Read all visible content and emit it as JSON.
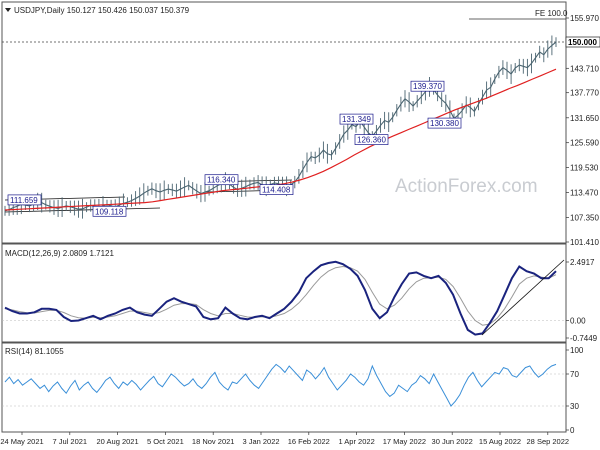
{
  "header": {
    "symbol_label": "USDJPY,Daily",
    "ohlc": "150.127 150.426 150.037 150.379",
    "marker_icon": "triangle-down-icon"
  },
  "watermark": "ActionForex.com",
  "fe_label": "FE 100.0",
  "current_price_label": "150.000",
  "price_levels": [
    {
      "label": "111.659",
      "value": 111.66
    },
    {
      "label": "109.118",
      "value": 109.12
    },
    {
      "label": "116.340",
      "value": 116.34
    },
    {
      "label": "114.408",
      "value": 114.41
    },
    {
      "label": "131.349",
      "value": 131.35
    },
    {
      "label": "126.360",
      "value": 126.36
    },
    {
      "label": "139.370",
      "value": 139.37
    },
    {
      "label": "130.380",
      "value": 130.38
    }
  ],
  "macd_label": "MACD(12,26,9) 2.0809 1.7121",
  "rsi_label": "RSI(14) 81.1055",
  "chart_data": [
    {
      "type": "line",
      "panel": "price",
      "y_ticks": [
        "155.970",
        "150.000",
        "143.710",
        "137.770",
        "131.650",
        "125.590",
        "119.530",
        "113.470",
        "107.350",
        "101.410"
      ],
      "ylim": [
        101.41,
        155.97
      ],
      "x_ticks": [
        "24 May 2021",
        "7 Jul 2021",
        "20 Aug 2021",
        "5 Oct 2021",
        "18 Nov 2021",
        "3 Jan 2022",
        "16 Feb 2022",
        "1 Apr 2022",
        "17 May 2022",
        "30 Jun 2022",
        "15 Aug 2022",
        "28 Sep 2022"
      ],
      "series": [
        {
          "name": "USDJPY",
          "color": "#4a6470",
          "values": [
            109.0,
            109.3,
            109.8,
            110.1,
            110.6,
            110.4,
            110.2,
            110.7,
            111.3,
            111.0,
            110.5,
            110.1,
            109.8,
            109.6,
            109.9,
            110.2,
            110.0,
            109.7,
            109.4,
            109.5,
            109.9,
            110.3,
            110.0,
            109.8,
            110.2,
            110.5,
            110.2,
            110.0,
            110.4,
            110.8,
            111.1,
            111.5,
            112.0,
            112.6,
            113.3,
            113.9,
            114.4,
            113.9,
            113.6,
            114.0,
            114.3,
            114.1,
            113.8,
            114.3,
            114.8,
            115.2,
            114.5,
            113.8,
            113.2,
            113.6,
            113.9,
            114.5,
            115.1,
            115.6,
            116.0,
            115.5,
            114.7,
            114.2,
            114.5,
            114.9,
            115.4,
            115.7,
            115.9,
            115.3,
            115.0,
            115.4,
            115.8,
            115.6,
            115.2,
            115.0,
            115.4,
            116.0,
            117.4,
            119.1,
            120.8,
            122.2,
            121.9,
            122.6,
            123.8,
            122.9,
            122.6,
            124.2,
            125.9,
            127.7,
            128.7,
            130.0,
            129.5,
            130.8,
            129.4,
            128.0,
            127.2,
            128.4,
            129.8,
            131.0,
            130.6,
            131.8,
            133.5,
            135.0,
            136.3,
            135.5,
            134.5,
            135.7,
            136.8,
            138.0,
            139.2,
            138.5,
            137.2,
            136.1,
            135.2,
            133.5,
            131.5,
            132.3,
            133.4,
            134.8,
            134.2,
            133.2,
            135.0,
            136.7,
            138.4,
            139.1,
            141.1,
            142.8,
            143.9,
            143.2,
            142.3,
            143.8,
            144.5,
            144.2,
            143.9,
            144.9,
            146.3,
            147.7,
            147.0,
            148.4,
            149.3,
            150.1
          ]
        },
        {
          "name": "MA",
          "color": "#e02020",
          "values": [
            109.2,
            109.3,
            109.4,
            109.5,
            109.6,
            109.7,
            109.8,
            109.9,
            110.0,
            110.1,
            110.2,
            110.3,
            110.4,
            110.5,
            110.6,
            110.7,
            110.8,
            110.9,
            111.0,
            111.2,
            111.5,
            111.8,
            112.1,
            112.4,
            112.7,
            113.0,
            113.3,
            113.6,
            113.9,
            114.1,
            114.3,
            114.5,
            114.7,
            114.9,
            115.1,
            115.3,
            115.6,
            116.0,
            116.5,
            117.1,
            117.8,
            118.6,
            119.5,
            120.5,
            121.5,
            122.6,
            123.6,
            124.6,
            125.5,
            126.4,
            127.2,
            128.0,
            128.8,
            129.6,
            130.4,
            131.2,
            132.0,
            132.8,
            133.6,
            134.3,
            135.0,
            135.7,
            136.4,
            137.2,
            138.0,
            138.8,
            139.5,
            140.3,
            141.1,
            141.9,
            142.7,
            143.5
          ]
        }
      ],
      "series_x": {
        "price_last_index": 136,
        "ma_last_index": 71
      },
      "annotations": [
        {
          "text": "FE 100.0",
          "y": 155.97
        },
        {
          "text": "150.000",
          "y": 150.0
        }
      ]
    },
    {
      "type": "line",
      "panel": "macd",
      "y_ticks": [
        "2.4917",
        "0.00",
        "-0.7449"
      ],
      "ylim": [
        -0.7449,
        2.4917
      ],
      "series": [
        {
          "name": "MACD",
          "color": "#1a237e",
          "values": [
            0.55,
            0.4,
            0.3,
            0.3,
            0.35,
            0.5,
            0.5,
            0.45,
            0.15,
            -0.02,
            0.0,
            0.1,
            0.2,
            0.05,
            0.2,
            0.3,
            0.45,
            0.55,
            0.35,
            0.25,
            0.2,
            0.5,
            0.8,
            0.95,
            0.8,
            0.7,
            0.6,
            0.15,
            0.05,
            0.1,
            0.55,
            0.3,
            0.1,
            0.05,
            0.15,
            0.2,
            0.1,
            0.3,
            0.5,
            0.8,
            1.2,
            1.8,
            2.1,
            2.35,
            2.45,
            2.5,
            2.4,
            2.2,
            1.9,
            1.3,
            0.5,
            0.1,
            0.35,
            1.0,
            1.55,
            2.0,
            2.05,
            1.9,
            1.8,
            1.9,
            1.6,
            1.1,
            0.3,
            -0.4,
            -0.6,
            -0.55,
            -0.1,
            0.4,
            1.1,
            1.8,
            2.3,
            2.1,
            2.0,
            1.8,
            1.8,
            2.1
          ],
          "mas": 0
        },
        {
          "name": "Signal",
          "color": "#9a9a9a",
          "values": [
            0.5,
            0.45,
            0.38,
            0.33,
            0.32,
            0.38,
            0.43,
            0.44,
            0.34,
            0.2,
            0.12,
            0.1,
            0.14,
            0.12,
            0.15,
            0.2,
            0.3,
            0.4,
            0.4,
            0.34,
            0.28,
            0.34,
            0.48,
            0.65,
            0.72,
            0.72,
            0.68,
            0.46,
            0.3,
            0.2,
            0.3,
            0.3,
            0.22,
            0.15,
            0.14,
            0.16,
            0.14,
            0.2,
            0.3,
            0.48,
            0.75,
            1.1,
            1.5,
            1.85,
            2.1,
            2.25,
            2.3,
            2.25,
            2.1,
            1.75,
            1.2,
            0.7,
            0.5,
            0.65,
            0.95,
            1.35,
            1.65,
            1.8,
            1.82,
            1.85,
            1.75,
            1.45,
            0.95,
            0.4,
            0.0,
            -0.2,
            -0.15,
            0.1,
            0.5,
            1.0,
            1.55,
            1.8,
            1.9,
            1.85,
            1.8,
            1.95
          ]
        }
      ]
    },
    {
      "type": "line",
      "panel": "rsi",
      "y_ticks": [
        "100",
        "70",
        "30",
        "0"
      ],
      "ylim": [
        0,
        100
      ],
      "series": [
        {
          "name": "RSI",
          "color": "#3a8fd8",
          "values": [
            60,
            66,
            58,
            63,
            56,
            60,
            64,
            58,
            52,
            56,
            48,
            55,
            60,
            52,
            46,
            55,
            62,
            50,
            56,
            60,
            52,
            47,
            54,
            62,
            66,
            58,
            52,
            60,
            56,
            62,
            57,
            50,
            56,
            62,
            67,
            58,
            54,
            62,
            70,
            66,
            60,
            55,
            58,
            64,
            56,
            52,
            58,
            66,
            72,
            60,
            54,
            50,
            60,
            58,
            64,
            70,
            62,
            56,
            52,
            60,
            68,
            76,
            82,
            78,
            72,
            80,
            74,
            68,
            62,
            75,
            71,
            64,
            70,
            78,
            66,
            58,
            50,
            56,
            62,
            70,
            66,
            60,
            56,
            64,
            80,
            68,
            58,
            48,
            42,
            46,
            56,
            52,
            48,
            56,
            60,
            68,
            64,
            58,
            70,
            60,
            50,
            40,
            30,
            36,
            44,
            56,
            66,
            72,
            62,
            54,
            60,
            66,
            72,
            70,
            78,
            76,
            68,
            66,
            72,
            78,
            80,
            72,
            66,
            70,
            76,
            80,
            82
          ]
        }
      ]
    }
  ]
}
